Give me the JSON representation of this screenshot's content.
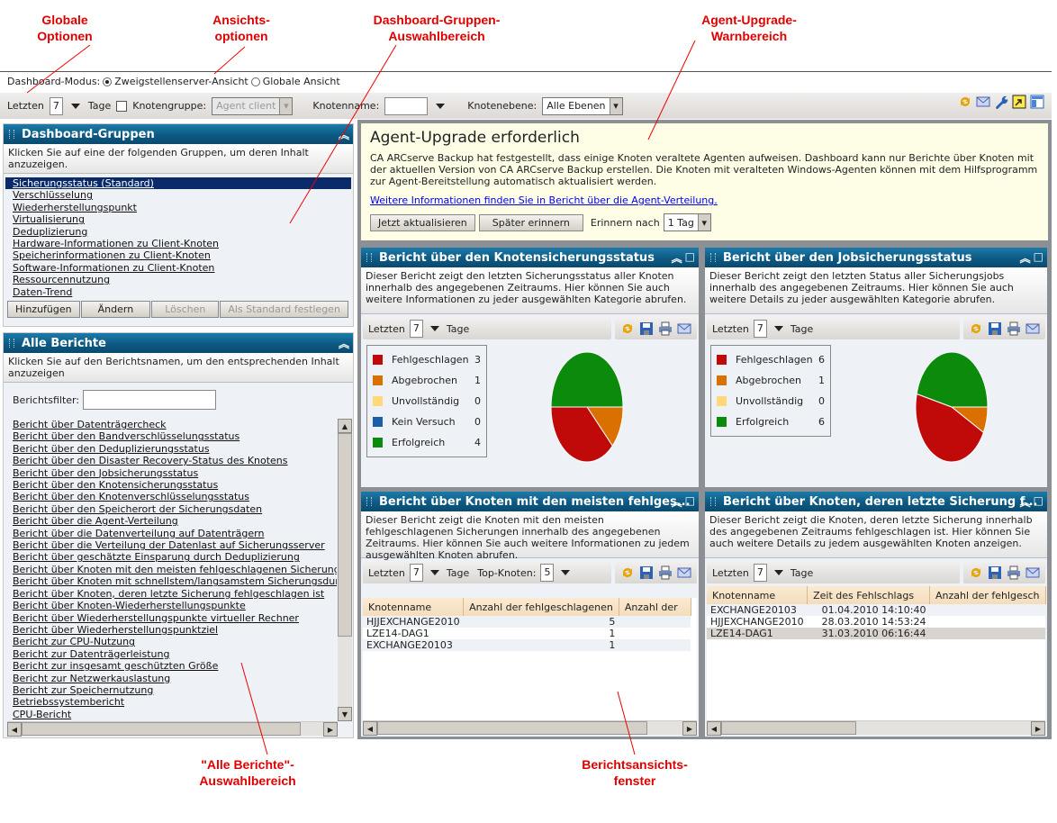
{
  "callouts": {
    "global": "Globale Optionen",
    "view": "Ansichts-optionen",
    "groups": "Dashboard-Gruppen-Auswahlbereich",
    "agent": "Agent-Upgrade-Warnbereich",
    "allreports": "\"Alle Berichte\"-Auswahlbereich",
    "reportview": "Berichtsansichts-fenster"
  },
  "mode": {
    "label": "Dashboard-Modus:",
    "option1": "Zweigstellenserver-Ansicht",
    "option2": "Globale Ansicht",
    "selected": "option1"
  },
  "toolbar": {
    "last_label": "Letzten",
    "days_value": "7",
    "days_label": "Tage",
    "nodegroup_label": "Knotengruppe:",
    "nodegroup_value": "Agent client",
    "nodename_label": "Knotenname:",
    "nodename_value": "",
    "nodelevel_label": "Knotenebene:",
    "nodelevel_value": "Alle Ebenen"
  },
  "groups": {
    "title": "Dashboard-Gruppen",
    "desc": "Klicken Sie auf eine der folgenden Gruppen, um deren Inhalt anzuzeigen.",
    "items": [
      "Sicherungsstatus (Standard)",
      "Verschlüsselung",
      "Wiederherstellungspunkt",
      "Virtualisierung",
      "Deduplizierung",
      "Hardware-Informationen zu Client-Knoten",
      "Speicherinformationen zu Client-Knoten",
      "Software-Informationen zu Client-Knoten",
      "Ressourcennutzung",
      "Daten-Trend"
    ],
    "selected": 0,
    "buttons": {
      "add": "Hinzufügen",
      "edit": "Ändern",
      "delete": "Löschen",
      "default": "Als Standard festlegen"
    }
  },
  "reports": {
    "title": "Alle Berichte",
    "desc": "Klicken Sie auf den Berichtsnamen, um den entsprechenden Inhalt anzuzeigen",
    "filter_label": "Berichtsfilter:",
    "filter_value": "",
    "items": [
      "Bericht über Datenträgercheck",
      "Bericht über den Bandverschlüsselungsstatus",
      "Bericht über den Deduplizierungsstatus",
      "Bericht über den Disaster Recovery-Status des Knotens",
      "Bericht über den Jobsicherungsstatus",
      "Bericht über den Knotensicherungsstatus",
      "Bericht über den Knotenverschlüsselungsstatus",
      "Bericht über den Speicherort der Sicherungsdaten",
      "Bericht über die Agent-Verteilung",
      "Bericht über die Datenverteilung auf Datenträgern",
      "Bericht über die Verteilung der Datenlast auf Sicherungsserver",
      "Bericht über geschätzte Einsparung durch Deduplizierung",
      "Bericht über Knoten mit den meisten fehlgeschlagenen Sicherungen",
      "Bericht über Knoten mit schnellstem/langsamstem Sicherungsdurchsatz",
      "Bericht über Knoten, deren letzte Sicherung fehlgeschlagen ist",
      "Bericht über Knoten-Wiederherstellungspunkte",
      "Bericht über Wiederherstellungspunkte virtueller Rechner",
      "Bericht über Wiederherstellungspunktziel",
      "Bericht zur CPU-Nutzung",
      "Bericht zur Datenträgerleistung",
      "Bericht zur insgesamt geschützten Größe",
      "Bericht zur Netzwerkauslastung",
      "Bericht zur Speichernutzung",
      "Betriebssystembericht",
      "CPU-Bericht"
    ]
  },
  "warning": {
    "title": "Agent-Upgrade erforderlich",
    "text": "CA ARCserve Backup hat festgestellt, dass einige Knoten veraltete Agenten aufweisen. Dashboard kann nur Berichte über Knoten mit der aktuellen Version von CA ARCserve Backup erstellen. Die Knoten mit veralteten Windows-Agenten können mit dem Hilfsprogramm zur Agent-Bereitstellung automatisch aktualisiert werden.",
    "link": "Weitere Informationen finden Sie in Bericht über die Agent-Verteilung.",
    "update_button": "Jetzt aktualisieren",
    "later_button": "Später erinnern",
    "remind_label": "Erinnern nach",
    "remind_value": "1 Tag"
  },
  "panels": {
    "node_status": {
      "title": "Bericht über den Knotensicherungsstatus",
      "desc": "Dieser Bericht zeigt den letzten Sicherungsstatus aller Knoten innerhalb des angegebenen Zeitraums. Hier können Sie auch weitere Informationen zu jeder ausgewählten Kategorie abrufen.",
      "last_label": "Letzten",
      "days_value": "7",
      "days_label": "Tage"
    },
    "job_status": {
      "title": "Bericht über den Jobsicherungsstatus",
      "desc": "Dieser Bericht zeigt den letzten Status aller Sicherungsjobs innerhalb des angegebenen Zeitraums. Hier können Sie auch weitere Details zu jeder ausgewählten Kategorie abrufen.",
      "last_label": "Letzten",
      "days_value": "7",
      "days_label": "Tage"
    },
    "most_failed": {
      "title": "Bericht über Knoten mit den meisten fehlges...",
      "desc": "Dieser Bericht zeigt die Knoten mit den meisten fehlgeschlagenen Sicherungen innerhalb des angegebenen Zeitraums. Hier können Sie auch weitere Informationen zu jedem ausgewählten Knoten abrufen.",
      "last_label": "Letzten",
      "days_value": "7",
      "days_label": "Tage",
      "top_label": "Top-Knoten:",
      "top_value": "5",
      "columns": [
        "Knotenname",
        "Anzahl der fehlgeschlagenen",
        "Anzahl der"
      ],
      "rows": [
        [
          "HJJEXCHANGE2010",
          "5",
          ""
        ],
        [
          "LZE14-DAG1",
          "1",
          ""
        ],
        [
          "EXCHANGE20103",
          "1",
          ""
        ]
      ]
    },
    "last_failed": {
      "title": "Bericht über Knoten, deren letzte Sicherung f...",
      "desc": "Dieser Bericht zeigt die Knoten, deren letzte Sicherung innerhalb des angegebenen Zeitraums fehlgeschlagen ist. Hier können Sie auch weitere Details zu jedem ausgewählten Knoten anzeigen.",
      "last_label": "Letzten",
      "days_value": "7",
      "days_label": "Tage",
      "columns": [
        "Knotenname",
        "Zeit des Fehlschlags",
        "Anzahl der fehlgesch"
      ],
      "rows": [
        [
          "EXCHANGE20103",
          "01.04.2010 14:10:40",
          ""
        ],
        [
          "HJJEXCHANGE2010",
          "28.03.2010 14:53:24",
          ""
        ],
        [
          "LZE14-DAG1",
          "31.03.2010 06:16:44",
          ""
        ]
      ],
      "selected_row": 2
    }
  },
  "chart_data": [
    {
      "type": "pie",
      "title": "Bericht über den Knotensicherungsstatus",
      "categories": [
        "Fehlgeschlagen",
        "Abgebrochen",
        "Unvollständig",
        "Kein Versuch",
        "Erfolgreich"
      ],
      "values": [
        3,
        1,
        0,
        0,
        4
      ],
      "colors": [
        "#c00a0a",
        "#d97000",
        "#ffd87a",
        "#1a5fa8",
        "#0c8a0c"
      ]
    },
    {
      "type": "pie",
      "title": "Bericht über den Jobsicherungsstatus",
      "categories": [
        "Fehlgeschlagen",
        "Abgebrochen",
        "Unvollständig",
        "Erfolgreich"
      ],
      "values": [
        6,
        1,
        0,
        6
      ],
      "colors": [
        "#c00a0a",
        "#d97000",
        "#ffd87a",
        "#0c8a0c"
      ]
    }
  ]
}
